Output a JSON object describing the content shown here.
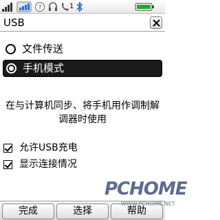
{
  "status_bar": {
    "icons": [
      "signal-strength-icon",
      "network-3g-icon",
      "unknown-status-icon",
      "headset-icon",
      "missed-call-icon",
      "bluetooth-icon",
      "battery-icon"
    ],
    "missed_call_count": "1"
  },
  "title_bar": {
    "title": "USB",
    "close_icon": "close-icon"
  },
  "options": [
    {
      "label": "文件传送",
      "selected": false
    },
    {
      "label": "手机模式",
      "selected": true
    }
  ],
  "description": "在与计算机同步、将手机用作调制解调器时使用",
  "checkboxes": [
    {
      "label": "允许USB充电",
      "checked": true
    },
    {
      "label": "显示连接情况",
      "checked": true
    }
  ],
  "softkeys": {
    "left": "完成",
    "middle": "选择",
    "right": "帮助"
  },
  "watermark": {
    "main": "PCHOME",
    "sub": "WWW.PCHOME.NET"
  },
  "colors": {
    "selected_bg": "#1a1a1a",
    "battery_green": "#22aa22",
    "bluetooth_blue": "#1f5fd1"
  }
}
